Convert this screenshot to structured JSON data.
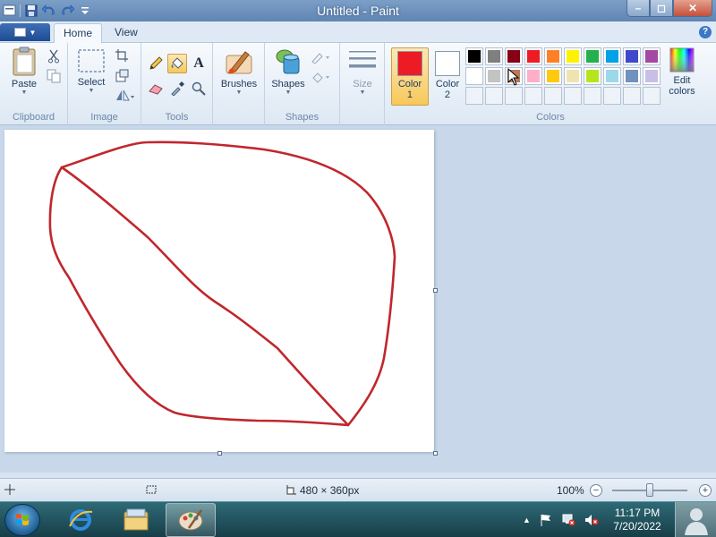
{
  "window": {
    "title": "Untitled - Paint",
    "minimize_glyph": "–",
    "maximize_glyph": "◻",
    "close_glyph": "✕"
  },
  "tabs": {
    "home": "Home",
    "view": "View",
    "help_glyph": "?"
  },
  "ribbon": {
    "clipboard": {
      "group_label": "Clipboard",
      "paste_label": "Paste"
    },
    "image": {
      "group_label": "Image",
      "select_label": "Select"
    },
    "tools": {
      "group_label": "Tools",
      "text_tool_glyph": "A"
    },
    "brushes": {
      "label": "Brushes"
    },
    "shapes": {
      "group_label": "Shapes",
      "shapes_label": "Shapes"
    },
    "size": {
      "label": "Size"
    },
    "colors": {
      "group_label": "Colors",
      "color1_label": "Color\n1",
      "color2_label": "Color\n2",
      "color1_value": "#ed1c24",
      "color2_value": "#ffffff",
      "edit_colors_label": "Edit\ncolors",
      "palette_row1": [
        "#000000",
        "#7f7f7f",
        "#880015",
        "#ed1c24",
        "#ff7f27",
        "#fff200",
        "#22b14c",
        "#00a2e8",
        "#3f48cc",
        "#a349a4"
      ],
      "palette_row2": [
        "#ffffff",
        "#c3c3c3",
        "#b97a57",
        "#ffaec9",
        "#ffc90e",
        "#efe4b0",
        "#b5e61d",
        "#99d9ea",
        "#7092be",
        "#c8bfe7"
      ]
    }
  },
  "drawing": {
    "stroke_color": "#c0272d"
  },
  "status": {
    "canvas_size": "480 × 360px",
    "zoom": "100%"
  },
  "taskbar": {
    "time": "11:17 PM",
    "date": "7/20/2022"
  }
}
